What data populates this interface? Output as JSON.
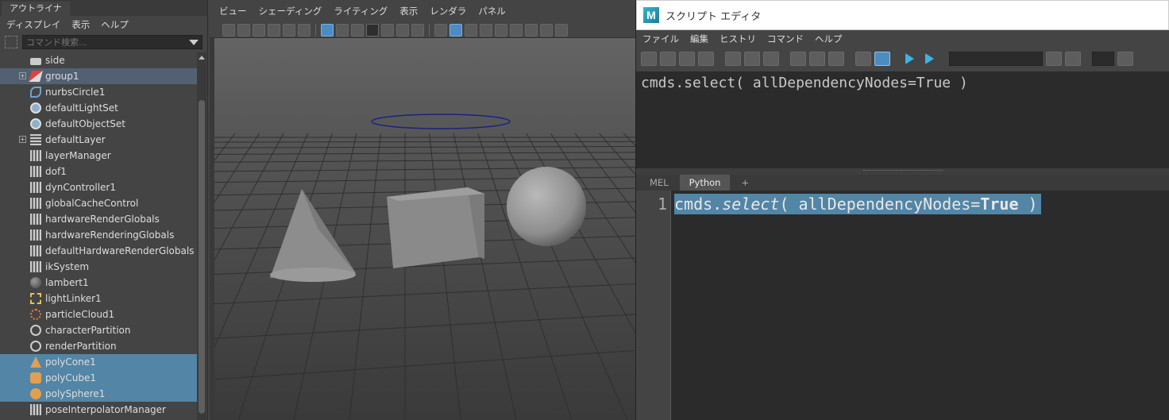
{
  "outliner": {
    "tab_label": "アウトライナ",
    "menu": [
      "ディスプレイ",
      "表示",
      "ヘルプ"
    ],
    "search_placeholder": "コマンド検索...",
    "items": [
      {
        "label": "side",
        "icon": "camera-icon",
        "state": "normal",
        "expandable": false
      },
      {
        "label": "group1",
        "icon": "group-icon",
        "state": "highlight",
        "expandable": true
      },
      {
        "label": "nurbsCircle1",
        "icon": "nurbs-curve-icon",
        "state": "normal",
        "expandable": false
      },
      {
        "label": "defaultLightSet",
        "icon": "set-icon",
        "state": "normal",
        "expandable": false
      },
      {
        "label": "defaultObjectSet",
        "icon": "set-icon",
        "state": "normal",
        "expandable": false
      },
      {
        "label": "defaultLayer",
        "icon": "layer-icon",
        "state": "normal",
        "expandable": true
      },
      {
        "label": "layerManager",
        "icon": "node-icon",
        "state": "normal",
        "expandable": false
      },
      {
        "label": "dof1",
        "icon": "node-icon",
        "state": "normal",
        "expandable": false
      },
      {
        "label": "dynController1",
        "icon": "node-icon",
        "state": "normal",
        "expandable": false
      },
      {
        "label": "globalCacheControl",
        "icon": "node-icon",
        "state": "normal",
        "expandable": false
      },
      {
        "label": "hardwareRenderGlobals",
        "icon": "node-icon",
        "state": "normal",
        "expandable": false
      },
      {
        "label": "hardwareRenderingGlobals",
        "icon": "node-icon",
        "state": "normal",
        "expandable": false
      },
      {
        "label": "defaultHardwareRenderGlobals",
        "icon": "node-icon",
        "state": "normal",
        "expandable": false
      },
      {
        "label": "ikSystem",
        "icon": "node-icon",
        "state": "normal",
        "expandable": false
      },
      {
        "label": "lambert1",
        "icon": "material-ball-icon",
        "state": "normal",
        "expandable": false
      },
      {
        "label": "lightLinker1",
        "icon": "light-linker-icon",
        "state": "normal",
        "expandable": false
      },
      {
        "label": "particleCloud1",
        "icon": "particle-icon",
        "state": "normal",
        "expandable": false
      },
      {
        "label": "characterPartition",
        "icon": "partition-icon",
        "state": "normal",
        "expandable": false
      },
      {
        "label": "renderPartition",
        "icon": "partition-icon",
        "state": "normal",
        "expandable": false
      },
      {
        "label": "polyCone1",
        "icon": "poly-cone-icon",
        "state": "selected",
        "expandable": false
      },
      {
        "label": "polyCube1",
        "icon": "poly-cube-icon",
        "state": "selected",
        "expandable": false
      },
      {
        "label": "polySphere1",
        "icon": "poly-sphere-icon",
        "state": "selected",
        "expandable": false
      },
      {
        "label": "poseInterpolatorManager",
        "icon": "node-icon",
        "state": "normal",
        "expandable": false
      }
    ]
  },
  "viewport": {
    "menu": [
      "ビュー",
      "シェーディング",
      "ライティング",
      "表示",
      "レンダラ",
      "パネル"
    ]
  },
  "script_editor": {
    "title": "スクリプト エディタ",
    "logo": "M",
    "menu": [
      "ファイル",
      "編集",
      "ヒストリ",
      "コマンド",
      "ヘルプ"
    ],
    "history_text": "cmds.select( allDependencyNodes=True )",
    "tabs": [
      "MEL",
      "Python",
      "+"
    ],
    "active_tab": "Python",
    "line_number": "1",
    "code": {
      "prefix": "cmds.",
      "func": "select",
      "args_open": "( allDependencyNodes=",
      "keyword": "True",
      "args_close": " )"
    }
  },
  "colors": {
    "selection": "#5285a6",
    "highlight": "#516172",
    "accent": "#3db3e3"
  }
}
